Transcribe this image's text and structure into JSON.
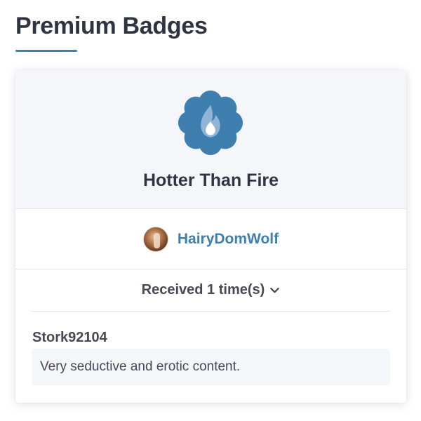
{
  "page": {
    "title": "Premium Badges"
  },
  "badge": {
    "icon": "fire-badge-icon",
    "name": "Hotter Than Fire",
    "colors": {
      "badge_blue": "#3f7fb0",
      "flame_light": "#8fb4d4"
    }
  },
  "giver": {
    "avatar": "user-avatar",
    "username": "HairyDomWolf"
  },
  "received": {
    "label": "Received 1 time(s)",
    "toggle_icon": "chevron-down-icon"
  },
  "comments": [
    {
      "author": "Stork92104",
      "text": "Very seductive and erotic content."
    }
  ],
  "theme": {
    "accent": "#3f7fb0",
    "text": "#2f3441",
    "panel_bg": "#f4f6f9"
  }
}
